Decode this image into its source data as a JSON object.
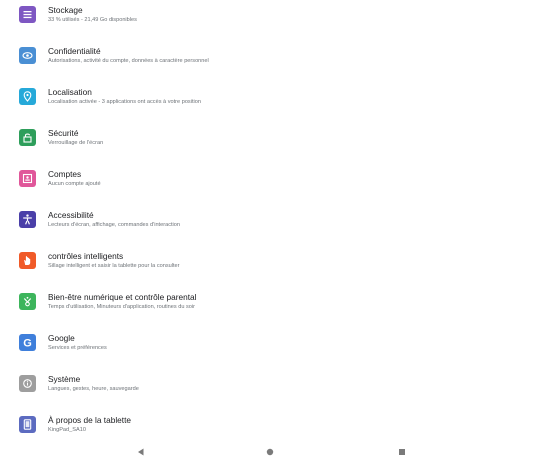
{
  "settings": {
    "items": [
      {
        "key": "storage",
        "title": "Stockage",
        "subtitle": "33 % utilisés - 21,49 Go disponibles",
        "icon": "storage-icon",
        "color": "#7e57c2"
      },
      {
        "key": "privacy",
        "title": "Confidentialité",
        "subtitle": "Autorisations, activité du compte, données à caractère personnel",
        "icon": "privacy-eye-icon",
        "color": "#4a8fd4"
      },
      {
        "key": "location",
        "title": "Localisation",
        "subtitle": "Localisation activée - 3 applications ont accès à votre position",
        "icon": "location-pin-icon",
        "color": "#26a9d9"
      },
      {
        "key": "security",
        "title": "Sécurité",
        "subtitle": "Verrouillage de l'écran",
        "icon": "lock-icon",
        "color": "#2e9e5b"
      },
      {
        "key": "accounts",
        "title": "Comptes",
        "subtitle": "Aucun compte ajouté",
        "icon": "account-icon",
        "color": "#e0579a"
      },
      {
        "key": "accessibility",
        "title": "Accessibilité",
        "subtitle": "Lecteurs d'écran, affichage, commandes d'interaction",
        "icon": "accessibility-icon",
        "color": "#4a3fa8"
      },
      {
        "key": "smart",
        "title": "contrôles intelligents",
        "subtitle": "Sillage intelligent et saisir la tablette pour la consulter",
        "icon": "hand-icon",
        "color": "#f05a28"
      },
      {
        "key": "wellbeing",
        "title": "Bien-être numérique et contrôle parental",
        "subtitle": "Temps d'utilisation, Minuteurs d'application, routines du soir",
        "icon": "wellbeing-icon",
        "color": "#3db55c"
      },
      {
        "key": "google",
        "title": "Google",
        "subtitle": "Services et préférences",
        "icon": "google-icon",
        "color": "#3f7fdb"
      },
      {
        "key": "system",
        "title": "Système",
        "subtitle": "Langues, gestes, heure, sauvegarde",
        "icon": "info-icon",
        "color": "#9e9e9e"
      },
      {
        "key": "about",
        "title": "À propos de la tablette",
        "subtitle": "KingPad_SA10",
        "icon": "tablet-icon",
        "color": "#5c6bc0"
      }
    ]
  },
  "navbar": {
    "back_icon": "back-triangle-icon",
    "home_icon": "home-circle-icon",
    "recents_icon": "recents-square-icon"
  }
}
